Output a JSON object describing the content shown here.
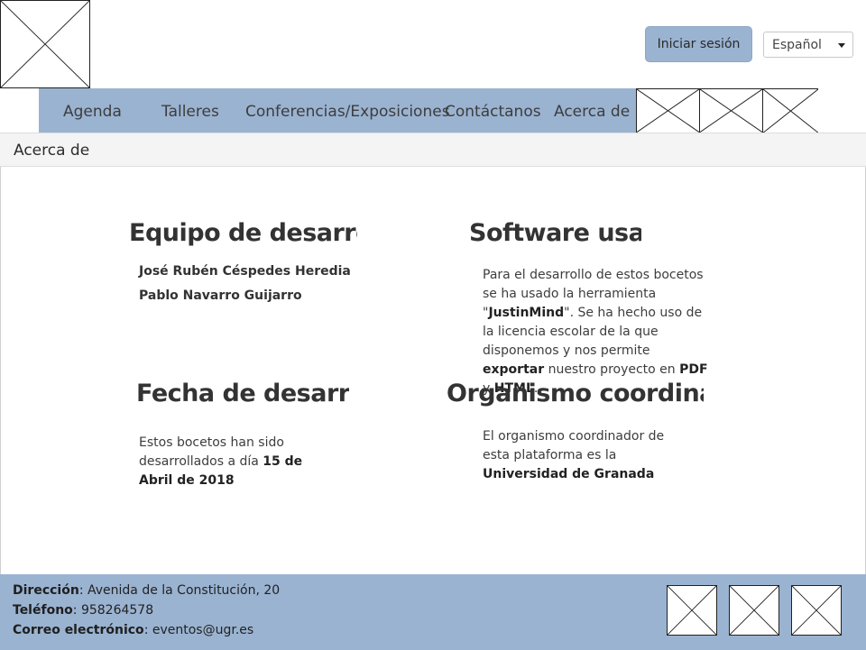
{
  "header": {
    "login_label": "Iniciar sesión",
    "language_selected": "Español"
  },
  "nav": {
    "items": [
      "Agenda",
      "Talleres",
      "Conferencias/Exposiciones",
      "Contáctanos",
      "Acerca de"
    ]
  },
  "page": {
    "title": "Acerca de"
  },
  "sections": {
    "team": {
      "heading": "Equipo de desarrollo",
      "members": [
        "José Rubén Céspedes Heredia",
        "Pablo Navarro Guijarro"
      ]
    },
    "software": {
      "heading": "Software usado",
      "t1": "Para el desarrollo de estos bocetos se ha usado la herramienta \"",
      "b1": "JustinMind",
      "t2": "\". Se ha hecho uso de la licencia escolar de la que disponemos y nos permite ",
      "b2": "exportar",
      "t3": " nuestro proyecto en ",
      "b3": "PDF",
      "t4": " y ",
      "b4": "HTML",
      "t5": "."
    },
    "date": {
      "heading": "Fecha de desarrollo",
      "t1": "Estos bocetos han sido desarrollados a día ",
      "b1": "15 de Abril de 2018"
    },
    "org": {
      "heading": "Organismo coordinador",
      "t1": "El organismo coordinador de esta plataforma es la ",
      "b1": "Universidad de Granada"
    }
  },
  "footer": {
    "address_label": "Dirección",
    "address_value": ": Avenida de la Constitución, 20",
    "phone_label": "Teléfono",
    "phone_value": ": 958264578",
    "email_label": "Correo electrónico",
    "email_value": ": eventos@ugr.es"
  }
}
